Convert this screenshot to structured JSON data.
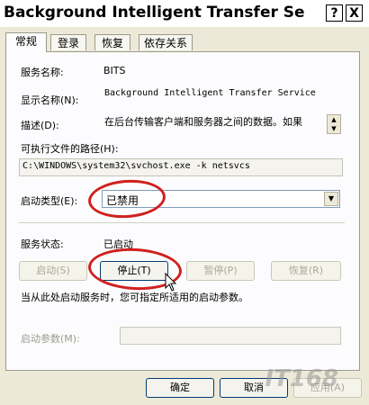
{
  "window": {
    "title": "Background Intelligent Transfer Se",
    "help_button": "?",
    "close_button": "X"
  },
  "tabs": [
    {
      "label": "常规",
      "active": true
    },
    {
      "label": "登录",
      "active": false
    },
    {
      "label": "恢复",
      "active": false
    },
    {
      "label": "依存关系",
      "active": false
    }
  ],
  "general": {
    "service_name_label": "服务名称:",
    "service_name_value": "BITS",
    "display_name_label": "显示名称(N):",
    "display_name_value": "Background Intelligent Transfer Service",
    "description_label": "描述(D):",
    "description_value": "在后台传输客户端和服务器之间的数据。如果",
    "exec_path_label": "可执行文件的路径(H):",
    "exec_path_value": "C:\\WINDOWS\\system32\\svchost.exe -k netsvcs",
    "startup_type_label": "启动类型(E):",
    "startup_type_value": "已禁用",
    "service_status_label": "服务状态:",
    "service_status_value": "已启动",
    "buttons": {
      "start": "启动(S)",
      "stop": "停止(T)",
      "pause": "暂停(P)",
      "resume": "恢复(R)"
    },
    "hint_text": "当从此处启动服务时，您可指定所适用的启动参数。",
    "start_params_label": "启动参数(M):",
    "start_params_value": ""
  },
  "footer": {
    "ok": "确定",
    "cancel": "取消",
    "apply": "应用(A)"
  },
  "watermark": "IT168",
  "annotation_color": "#d0201e"
}
